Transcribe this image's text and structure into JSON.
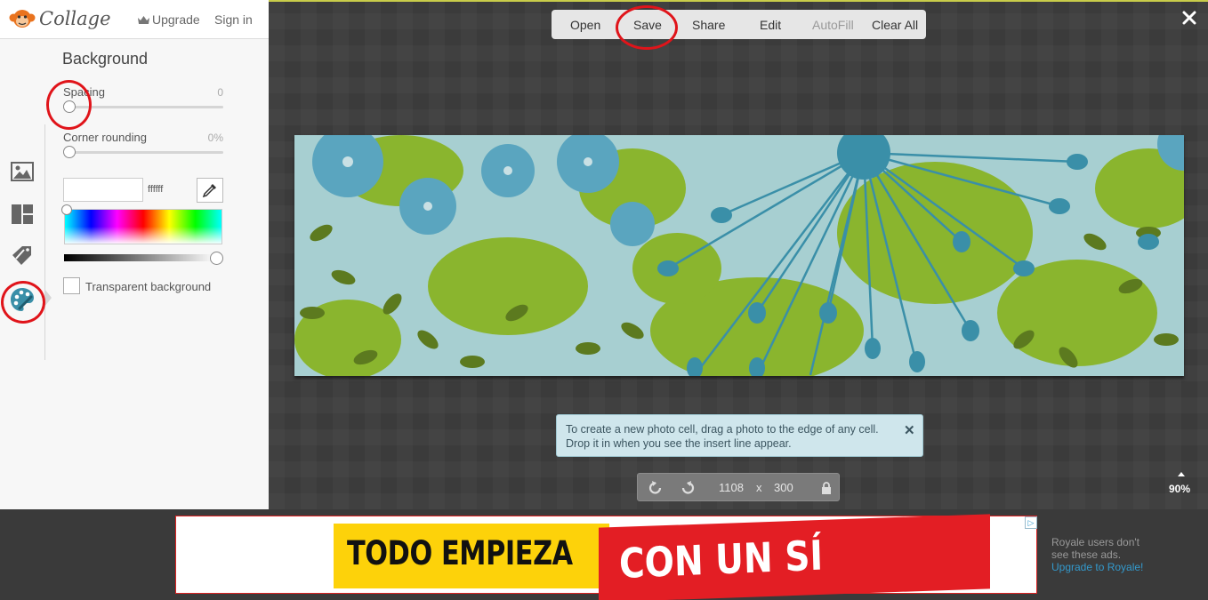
{
  "app": {
    "logo_text": "Collage",
    "upgrade": "Upgrade",
    "signin": "Sign in"
  },
  "panel": {
    "title": "Background",
    "spacing": {
      "label": "Spacing",
      "value": "0",
      "level": 0
    },
    "corner": {
      "label": "Corner rounding",
      "value": "0%",
      "level": 0
    },
    "color_hex": "ffffff",
    "transparent_label": "Transparent background",
    "transparent_checked": false
  },
  "rail": {
    "items": [
      "image-icon",
      "layout-icon",
      "stickers-icon",
      "palette-icon"
    ],
    "active": "palette-icon"
  },
  "toolbar": {
    "open": "Open",
    "save": "Save",
    "share": "Share",
    "edit": "Edit",
    "autofill": "AutoFill",
    "clear_all": "Clear All"
  },
  "tip": {
    "text": "To create a new photo cell, drag a photo to the edge of any cell. Drop it in when you see the insert line appear.",
    "close": "✕"
  },
  "size": {
    "width": "1108",
    "separator": "x",
    "height": "300"
  },
  "zoom": "90%",
  "ad": {
    "line1": "TODO EMPIEZA",
    "line2": "CON UN SÍ",
    "choice": "▷",
    "royale_note": "Royale users don't see these ads.",
    "royale_link": "Upgrade to Royale!"
  },
  "colors": {
    "accent_red": "#e0141a",
    "teal": "#3a8fa8",
    "green": "#8ab52e",
    "dark_green": "#5c7a1f"
  }
}
